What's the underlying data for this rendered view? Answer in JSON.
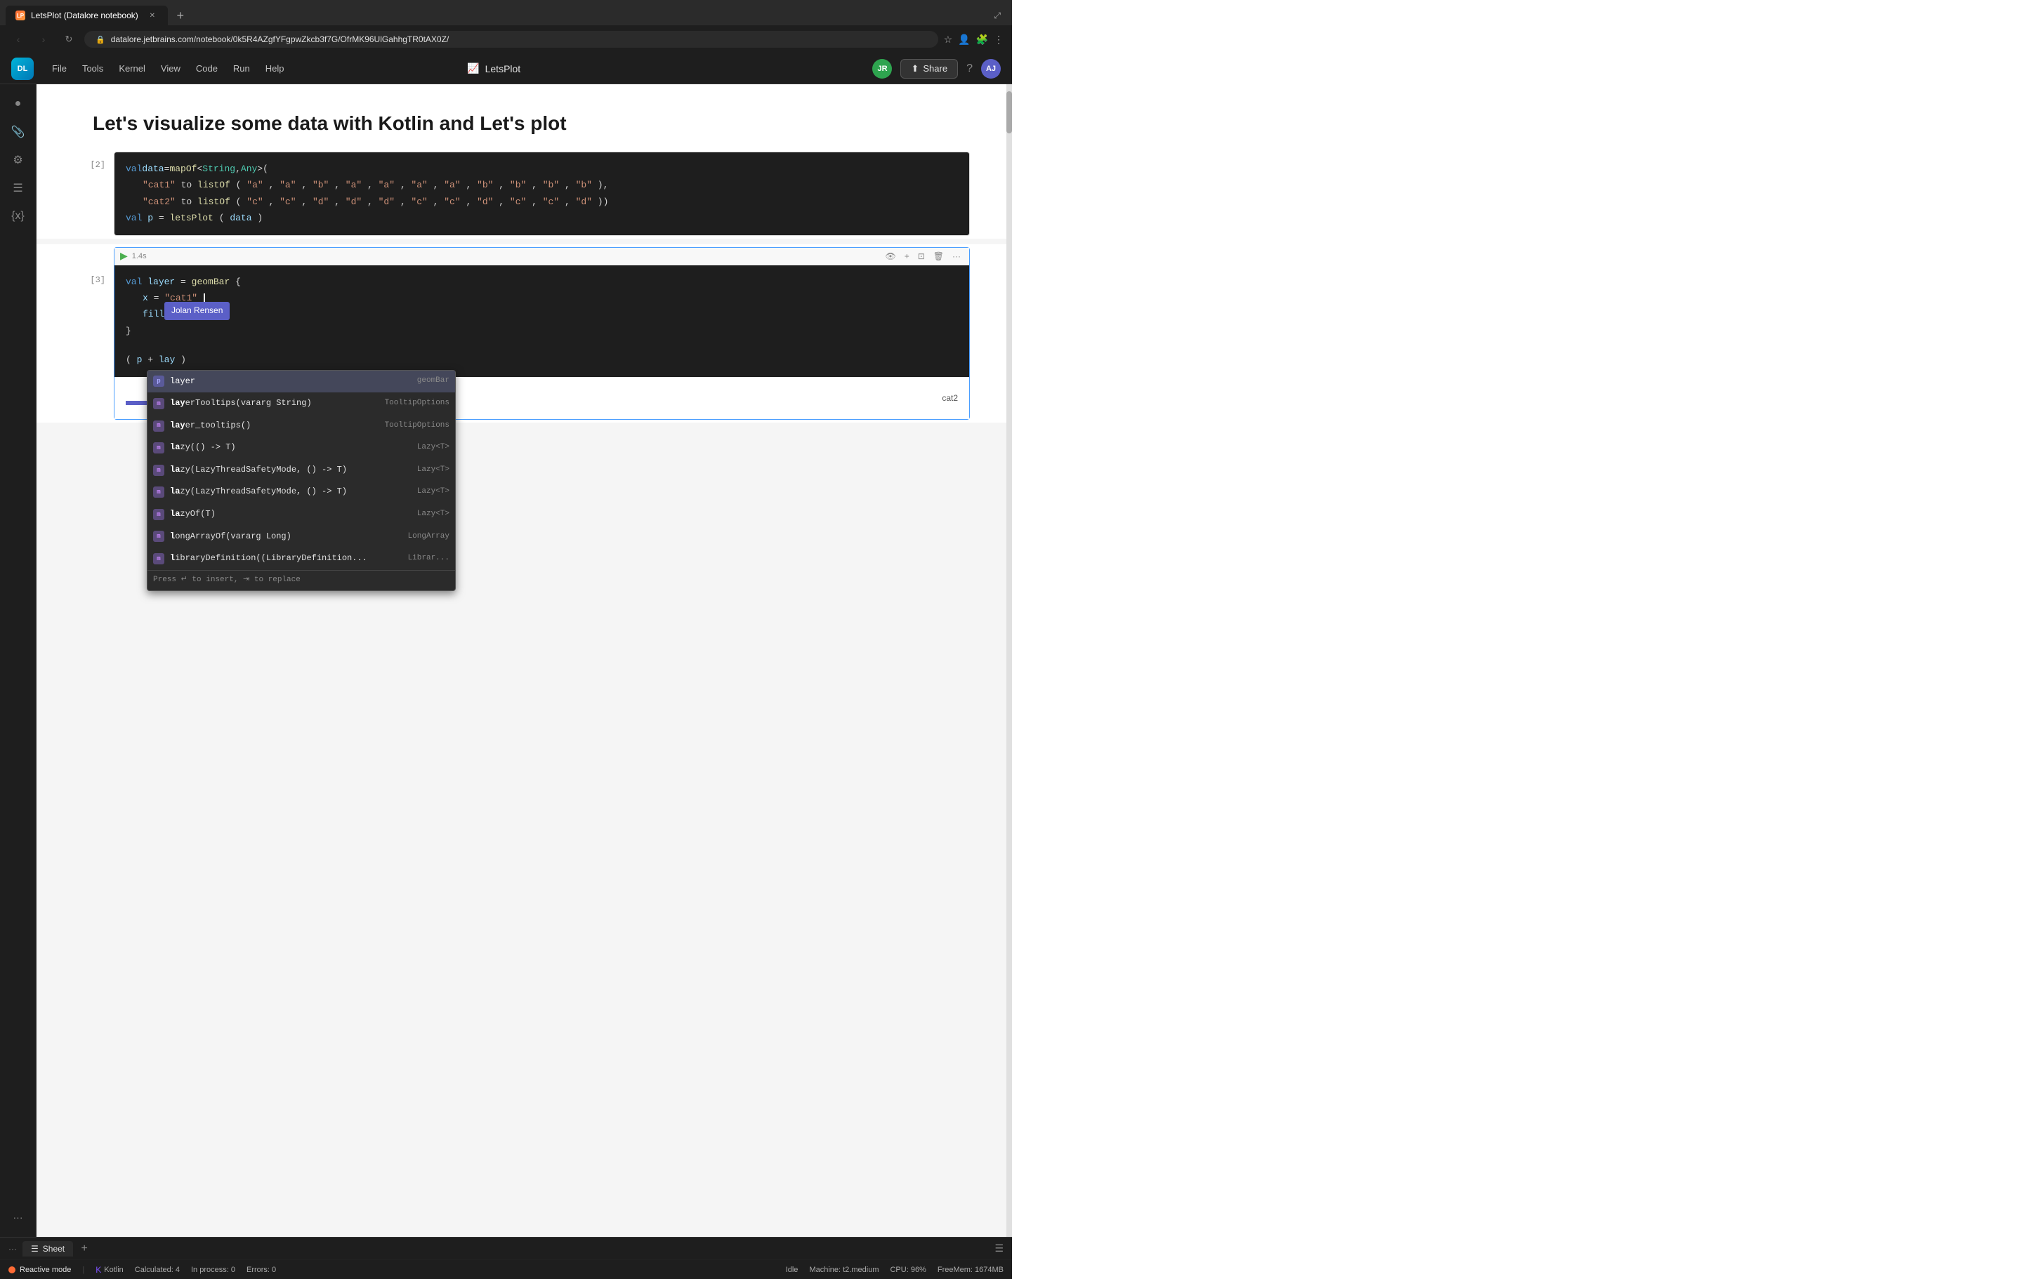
{
  "browser": {
    "tab_title": "LetsPlot (Datalore notebook)",
    "url": "datalore.jetbrains.com/notebook/0k5R4AZgfYFgpwZkcb3f7G/OfrMK96UlGahhgTR0tAX0Z/",
    "new_tab_label": "+",
    "back_disabled": true,
    "forward_disabled": true
  },
  "appbar": {
    "logo_text": "DL",
    "menu": [
      "File",
      "Tools",
      "Kernel",
      "View",
      "Code",
      "Run",
      "Help"
    ],
    "title": "LetsPlot",
    "title_icon": "📈",
    "user_initials_left": "JR",
    "user_initials_right": "AJ",
    "share_label": "Share",
    "help_icon": "?"
  },
  "sidebar": {
    "icons": [
      "●",
      "📎",
      "⚙",
      "☰",
      "{x}"
    ]
  },
  "notebook": {
    "title": "Let's visualize some data with Kotlin and Let's plot",
    "cells": [
      {
        "number": "[2]",
        "type": "code",
        "active": false,
        "code_lines": [
          "val data = mapOf<String, Any>(",
          "    \"cat1\" to listOf(\"a\", \"a\", \"b\", \"a\", \"a\", \"a\", \"a\", \"b\", \"b\", \"b\", \"b\"),",
          "    \"cat2\" to listOf(\"c\", \"c\", \"d\", \"d\", \"d\", \"c\", \"c\", \"d\", \"c\", \"c\", \"d\"))",
          "val p = letsPlot(data)"
        ]
      },
      {
        "number": "[3]",
        "type": "code",
        "active": true,
        "timing": "1.4s",
        "code_lines": [
          "val layer = geomBar {",
          "    x = \"cat1\"",
          "    fill = \"ca",
          "}"
        ],
        "second_block": "(p + lay"
      }
    ]
  },
  "autocomplete": {
    "items": [
      {
        "icon": "p",
        "label": "layer",
        "type": "geomBar",
        "selected": true
      },
      {
        "icon": "m",
        "label": "layerTooltips(vararg String)",
        "type": "TooltipOptions",
        "selected": false
      },
      {
        "icon": "m",
        "label": "layer_tooltips()",
        "type": "TooltipOptions",
        "selected": false
      },
      {
        "icon": "m",
        "label": "lazy(() -> T)",
        "type": "Lazy<T>",
        "selected": false
      },
      {
        "icon": "m",
        "label": "lazy(LazyThreadSafetyMode, () -> T)",
        "type": "Lazy<T>",
        "selected": false
      },
      {
        "icon": "m",
        "label": "lazy(LazyThreadSafetyMode, () -> T)",
        "type": "Lazy<T>",
        "selected": false
      },
      {
        "icon": "m",
        "label": "lazyOf(T)",
        "type": "Lazy<T>",
        "selected": false
      },
      {
        "icon": "m",
        "label": "longArrayOf(vararg Long)",
        "type": "LongArray",
        "selected": false
      },
      {
        "icon": "m",
        "label": "libraryDefinition((LibraryDefinition...",
        "type": "Librar...",
        "selected": false
      }
    ],
    "hint": "Press ↵ to insert, ⇥ to replace"
  },
  "tooltip": {
    "text": "Jolan Rensen"
  },
  "chart": {
    "label": "cat2",
    "bars": [
      {
        "color": "#5b5fc7",
        "height": 60
      },
      {
        "color": "#ff7043",
        "height": 60
      }
    ]
  },
  "status_bar": {
    "reactive_mode": "Reactive mode",
    "language": "Kotlin",
    "calculated": "Calculated: 4",
    "in_process": "In process: 0",
    "errors": "Errors: 0",
    "idle": "Idle",
    "machine": "Machine: t2.medium",
    "cpu": "CPU: 96%",
    "free_mem": "FreeMem: 1674MB"
  },
  "sheet": {
    "label": "Sheet",
    "add_label": "+"
  }
}
